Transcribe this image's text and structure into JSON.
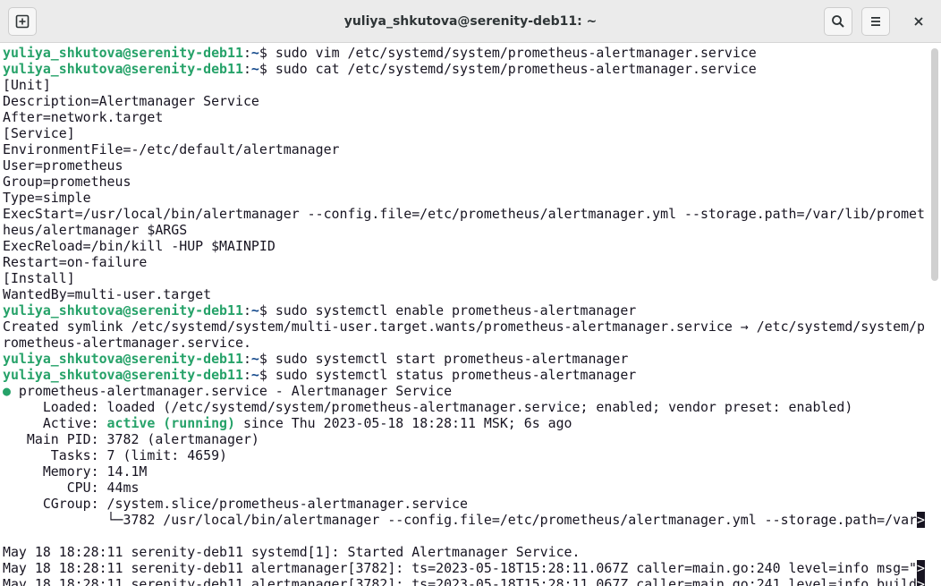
{
  "window": {
    "title": "yuliya_shkutova@serenity-deb11: ~"
  },
  "icons": {
    "new_tab": "new-tab-icon",
    "search": "search-icon",
    "menu": "hamburger-menu-icon",
    "close": "close-icon"
  },
  "colors": {
    "prompt_user": "#26a269",
    "prompt_path": "#12488b",
    "text": "#171421",
    "titlebar": "#ebebeb"
  },
  "prompt": {
    "user": "yuliya_shkutova@serenity-deb11",
    "sep": ":",
    "path": "~",
    "symbol": "$ "
  },
  "terminal": {
    "cmd1": "sudo vim /etc/systemd/system/prometheus-alertmanager.service",
    "cmd2": "sudo cat /etc/systemd/system/prometheus-alertmanager.service",
    "unit_file": [
      "[Unit]",
      "Description=Alertmanager Service",
      "After=network.target",
      "[Service]",
      "EnvironmentFile=-/etc/default/alertmanager",
      "User=prometheus",
      "Group=prometheus",
      "Type=simple",
      "ExecStart=/usr/local/bin/alertmanager --config.file=/etc/prometheus/alertmanager.yml --storage.path=/var/lib/promet",
      "heus/alertmanager $ARGS",
      "ExecReload=/bin/kill -HUP $MAINPID",
      "Restart=on-failure",
      "[Install]",
      "WantedBy=multi-user.target"
    ],
    "cmd3": "sudo systemctl enable prometheus-alertmanager",
    "symlink_1": "Created symlink /etc/systemd/system/multi-user.target.wants/prometheus-alertmanager.service → /etc/systemd/system/p",
    "symlink_2": "rometheus-alertmanager.service.",
    "cmd4": "sudo systemctl start prometheus-alertmanager",
    "cmd5": "sudo systemctl status prometheus-alertmanager",
    "status": {
      "dot": "●",
      "header": " prometheus-alertmanager.service - Alertmanager Service",
      "loaded": "     Loaded: loaded (/etc/systemd/system/prometheus-alertmanager.service; enabled; vendor preset: enabled)",
      "active_label": "     Active: ",
      "active_state": "active (running)",
      "active_rest": " since Thu 2023-05-18 18:28:11 MSK; 6s ago",
      "main_pid": "   Main PID: 3782 (alertmanager)",
      "tasks": "      Tasks: 7 (limit: 4659)",
      "memory": "     Memory: 14.1M",
      "cpu": "        CPU: 44ms",
      "cgroup": "     CGroup: /system.slice/prometheus-alertmanager.service",
      "cgroup_child": "             └─3782 /usr/local/bin/alertmanager --config.file=/etc/prometheus/alertmanager.yml --storage.path=/var",
      "truncate_mark": ">"
    },
    "journal": [
      "May 18 18:28:11 serenity-deb11 systemd[1]: Started Alertmanager Service.",
      "May 18 18:28:11 serenity-deb11 alertmanager[3782]: ts=2023-05-18T15:28:11.067Z caller=main.go:240 level=info msg=\"",
      "May 18 18:28:11 serenity-deb11 alertmanager[3782]: ts=2023-05-18T15:28:11.067Z caller=main.go:241 level=info build"
    ]
  }
}
